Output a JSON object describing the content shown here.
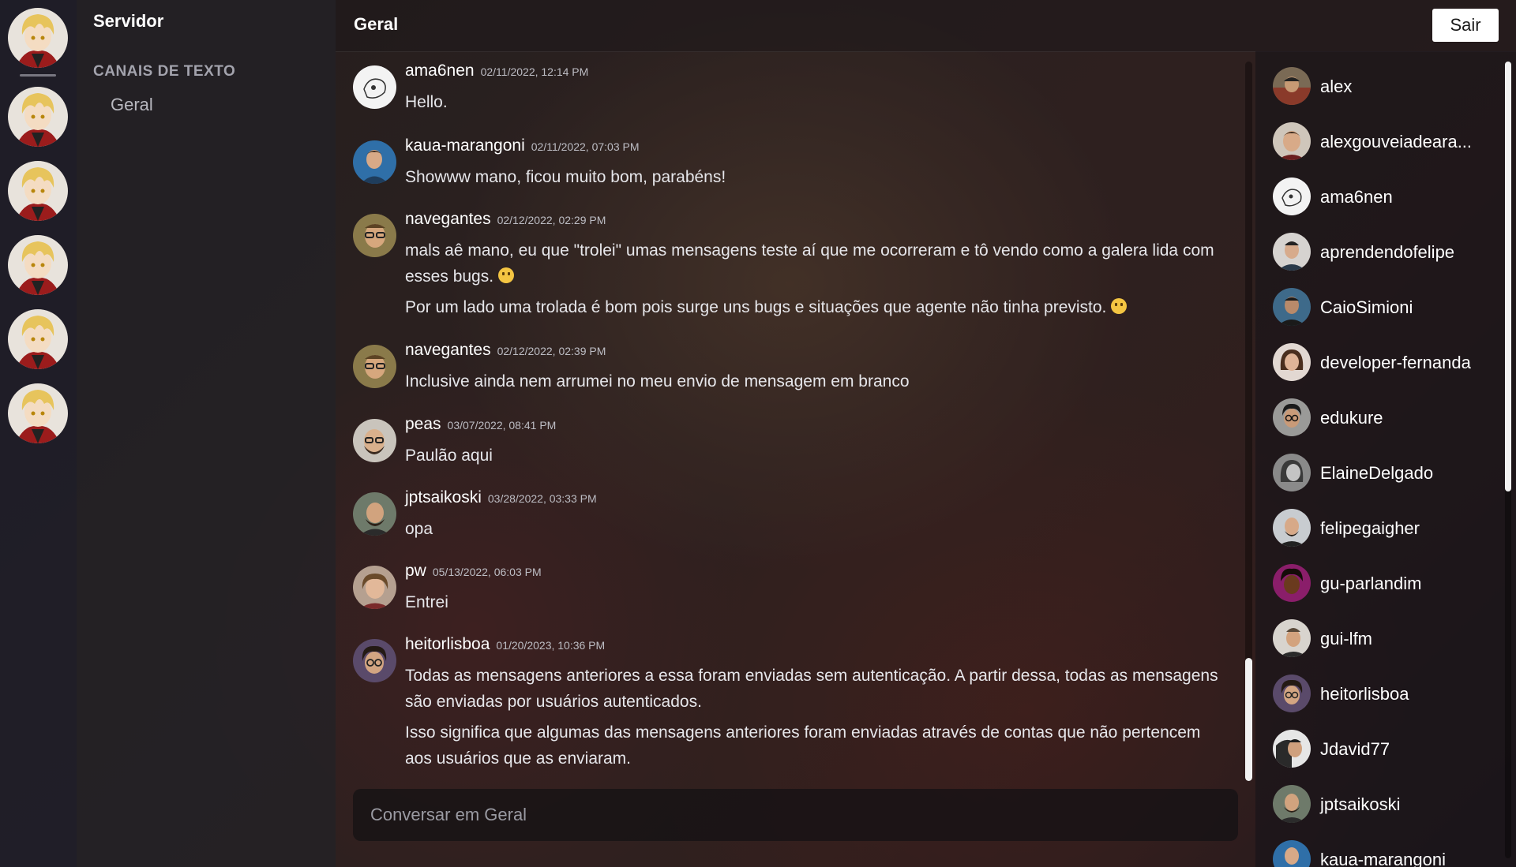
{
  "server": {
    "name": "Servidor",
    "category": "CANAIS DE TEXTO",
    "channel": "Geral"
  },
  "header": {
    "title": "Geral",
    "logout_label": "Sair"
  },
  "messages": [
    {
      "author": "ama6nen",
      "time": "02/11/2022, 12:14 PM",
      "lines": [
        "Hello."
      ]
    },
    {
      "author": "kaua-marangoni",
      "time": "02/11/2022, 07:03 PM",
      "lines": [
        "Showww mano, ficou muito bom, parabéns!"
      ]
    },
    {
      "author": "navegantes",
      "time": "02/12/2022, 02:29 PM",
      "lines": [
        "mals aê mano, eu que \"trolei\" umas mensagens teste aí que me ocorreram e tô vendo como a galera lida com esses bugs.",
        "Por um lado uma trolada é bom pois surge uns bugs e situações que agente não tinha previsto."
      ]
    },
    {
      "author": "navegantes",
      "time": "02/12/2022, 02:39 PM",
      "lines": [
        "Inclusive ainda nem arrumei no meu envio de mensagem em branco"
      ]
    },
    {
      "author": "peas",
      "time": "03/07/2022, 08:41 PM",
      "lines": [
        "Paulão aqui"
      ]
    },
    {
      "author": "jptsaikoski",
      "time": "03/28/2022, 03:33 PM",
      "lines": [
        "opa"
      ]
    },
    {
      "author": "pw",
      "time": "05/13/2022, 06:03 PM",
      "lines": [
        "Entrei"
      ]
    },
    {
      "author": "heitorlisboa",
      "time": "01/20/2023, 10:36 PM",
      "lines": [
        "Todas as mensagens anteriores a essa foram enviadas sem autenticação. A partir dessa, todas as mensagens são enviadas por usuários autenticados.",
        "Isso significa que algumas das mensagens anteriores foram enviadas através de contas que não pertencem aos usuários que as enviaram."
      ]
    }
  ],
  "composer": {
    "placeholder": "Conversar em Geral"
  },
  "members": [
    "alex",
    "alexgouveiadeara...",
    "ama6nen",
    "aprendendofelipe",
    "CaioSimioni",
    "developer-fernanda",
    "edukure",
    "ElaineDelgado",
    "felipegaigher",
    "gu-parlandim",
    "gui-lfm",
    "heitorlisboa",
    "Jdavid77",
    "jptsaikoski",
    "kaua-marangoni"
  ],
  "colors": {
    "logout_bg": "#ffffff",
    "muted_text": "#a3a3ad",
    "scroll_thumb": "#f2f2f2"
  }
}
